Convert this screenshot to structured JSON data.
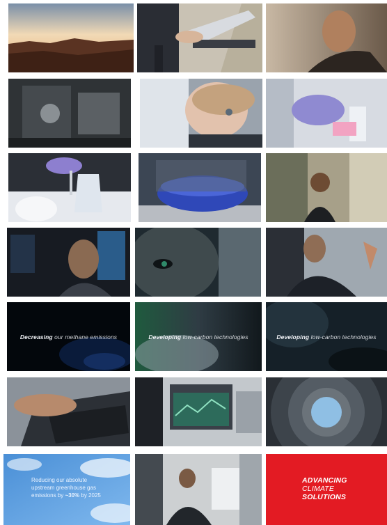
{
  "captions": {
    "methane": {
      "bold": "Decreasing",
      "rest": " our methane emissions"
    },
    "lowcarbon_a": {
      "bold": "Developing",
      "rest": " low-carbon technologies"
    },
    "lowcarbon_b": {
      "bold": "Developing",
      "rest": " low-carbon technologies"
    }
  },
  "reduction": {
    "line1": "Reducing our absolute",
    "line2": "upstream greenhouse gas",
    "line3_pre": "emissions by ",
    "line3_value": "~30%",
    "line3_post": " by 2025"
  },
  "brand": {
    "line1": "ADVANCING",
    "line2": "CLIMATE",
    "line3": "SOLUTIONS",
    "color": "#e31b23"
  }
}
